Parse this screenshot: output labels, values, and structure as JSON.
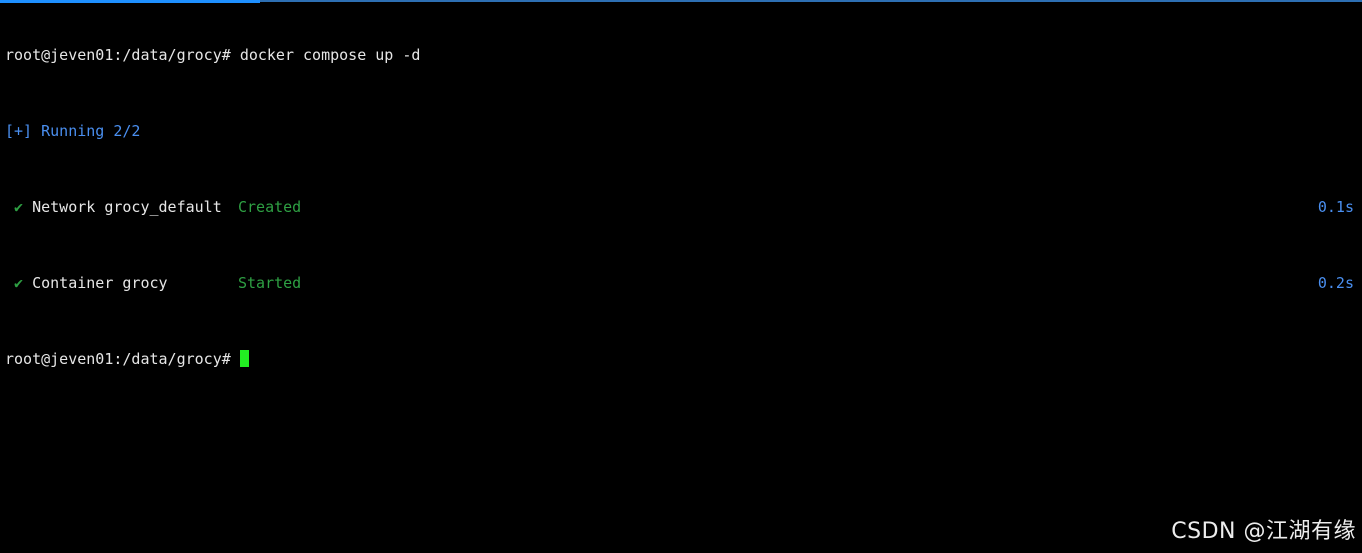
{
  "terminal": {
    "prompt_1": "root@jeven01:/data/grocy#",
    "command_1": "docker compose up -d",
    "running_status": "[+] Running 2/2",
    "items": [
      {
        "check": "✔",
        "label": "Network grocy_default",
        "status": "Created",
        "timing": "0.1s"
      },
      {
        "check": "✔",
        "label": "Container grocy",
        "status": "Started",
        "timing": "0.2s"
      }
    ],
    "prompt_2": "root@jeven01:/data/grocy#"
  },
  "watermark": "CSDN @江湖有缘",
  "colors": {
    "background": "#000000",
    "text": "#e6e6e6",
    "accent_blue": "#4a8ff0",
    "status_green": "#2ea043",
    "cursor_green": "#22ee22"
  }
}
